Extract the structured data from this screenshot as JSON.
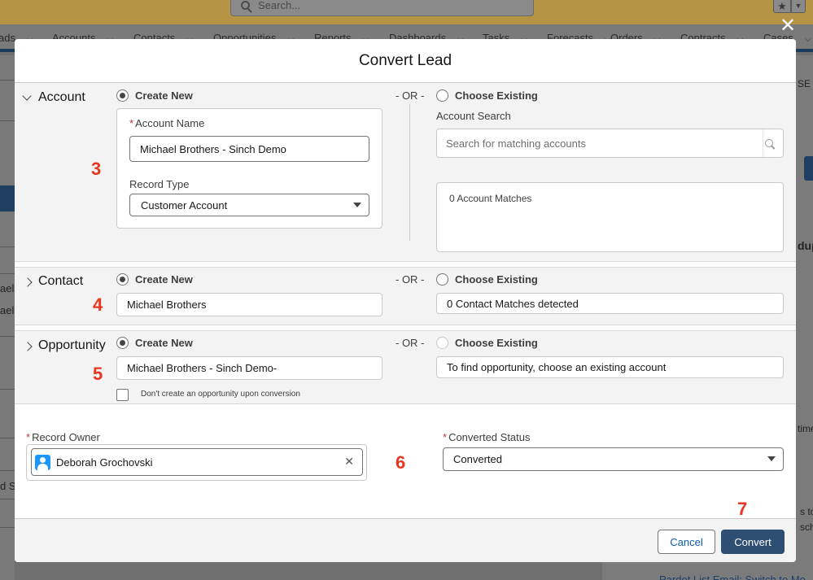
{
  "background": {
    "search_placeholder": "Search...",
    "nav_items": [
      "ads",
      "Accounts",
      "Contacts",
      "Opportunities",
      "Reports",
      "Dashboards",
      "Tasks",
      "Forecasts",
      "Orders",
      "Contracts",
      "Cases"
    ],
    "left_fragments": [
      "ael",
      "ael",
      "d S"
    ],
    "right_fragments": [
      "SE",
      "dup",
      "time",
      "s to",
      "sch"
    ],
    "bottom_link": "Pardot List Email: Switch to Mo"
  },
  "modal": {
    "title": "Convert Lead",
    "or_text": "- OR -",
    "account": {
      "label": "Account",
      "create_new": "Create New",
      "choose_existing": "Choose Existing",
      "account_name_label": "Account Name",
      "account_name_value": "Michael Brothers - Sinch Demo",
      "record_type_label": "Record Type",
      "record_type_value": "Customer Account",
      "search_label": "Account Search",
      "search_placeholder": "Search for matching accounts",
      "matches": "0 Account Matches",
      "step": "3"
    },
    "contact": {
      "label": "Contact",
      "create_new": "Create New",
      "choose_existing": "Choose Existing",
      "name_value": "Michael Brothers",
      "matches": "0 Contact Matches detected",
      "step": "4"
    },
    "opportunity": {
      "label": "Opportunity",
      "create_new": "Create New",
      "choose_existing": "Choose Existing",
      "name_value": "Michael Brothers - Sinch Demo-",
      "existing_hint": "To find opportunity, choose an existing account",
      "no_opp_label": "Don't create an opportunity upon conversion",
      "step": "5"
    },
    "owner": {
      "label": "Record Owner",
      "value": "Deborah Grochovski",
      "step": "6"
    },
    "status": {
      "label": "Converted Status",
      "value": "Converted"
    },
    "footer": {
      "cancel": "Cancel",
      "convert": "Convert",
      "step": "7"
    }
  },
  "colors": {
    "annotation": "#e8361f",
    "brand_button": "#2e4e74",
    "avatar": "#1b96ff"
  }
}
